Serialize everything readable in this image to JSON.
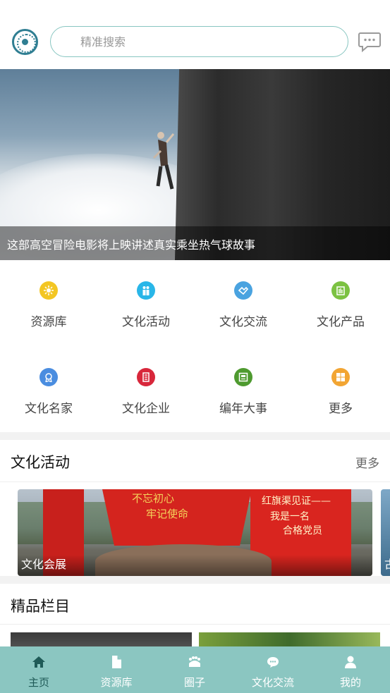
{
  "header": {
    "search_placeholder": "精准搜索"
  },
  "banner": {
    "caption": "这部高空冒险电影将上映讲述真实乘坐热气球故事"
  },
  "menu": [
    {
      "label": "资源库",
      "icon": "resource-icon",
      "color": "#f3c623"
    },
    {
      "label": "文化活动",
      "icon": "activity-icon",
      "color": "#29b6e8"
    },
    {
      "label": "文化交流",
      "icon": "exchange-icon",
      "color": "#4aa3e0"
    },
    {
      "label": "文化产品",
      "icon": "product-icon",
      "color": "#7cc242"
    },
    {
      "label": "文化名家",
      "icon": "master-icon",
      "color": "#4a8de0"
    },
    {
      "label": "文化企业",
      "icon": "enterprise-icon",
      "color": "#d8273b"
    },
    {
      "label": "编年大事",
      "icon": "chronicle-icon",
      "color": "#4e9a2f"
    },
    {
      "label": "更多",
      "icon": "more-icon",
      "color": "#f2a533"
    }
  ],
  "activities": {
    "title": "文化活动",
    "more": "更多",
    "cards": [
      {
        "label": "文化会展",
        "image_text": [
          "不忘初心",
          "牢记使命",
          "红旗渠见证——",
          "我是一名",
          "合格党员"
        ]
      },
      {
        "label": "古"
      }
    ]
  },
  "featured": {
    "title": "精品栏目"
  },
  "tabs": [
    {
      "label": "主页",
      "icon": "home-icon",
      "active": true
    },
    {
      "label": "资源库",
      "icon": "document-icon",
      "active": false
    },
    {
      "label": "圈子",
      "icon": "group-icon",
      "active": false
    },
    {
      "label": "文化交流",
      "icon": "chat-bubble-icon",
      "active": false
    },
    {
      "label": "我的",
      "icon": "user-icon",
      "active": false
    }
  ],
  "colors": {
    "accent": "#8bc6c1",
    "active_tab": "#1f5a57"
  }
}
